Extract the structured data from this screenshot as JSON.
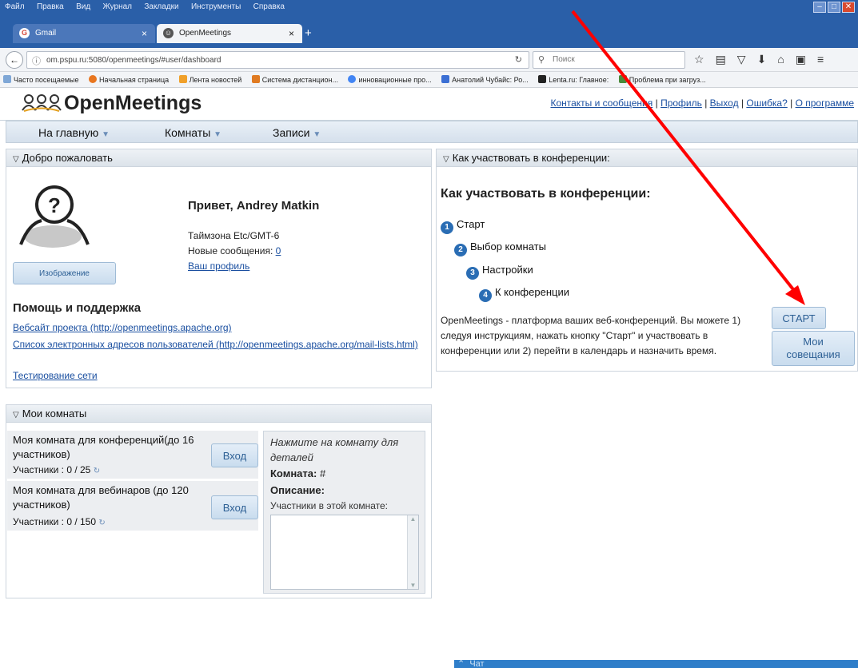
{
  "browser": {
    "menu": [
      "Файл",
      "Правка",
      "Вид",
      "Журнал",
      "Закладки",
      "Инструменты",
      "Справка"
    ],
    "tabs": [
      {
        "label": "Gmail",
        "icon": "gmail-icon"
      },
      {
        "label": "OpenMeetings",
        "icon": "openmeetings-icon"
      }
    ],
    "url": "om.pspu.ru:5080/openmeetings/#user/dashboard",
    "search_placeholder": "Поиск",
    "bookmarks": [
      "Часто посещаемые",
      "Начальная страница",
      "Лента новостей",
      "Система дистанцион...",
      "инновационные про...",
      "Анатолий Чубайс: Ро...",
      "Lenta.ru: Главное:",
      "Проблема при загруз..."
    ]
  },
  "app": {
    "logo": "OpenMeetings",
    "top_links": [
      "Контакты и сообщения",
      "Профиль",
      "Выход",
      "Ошибка?",
      "О программе"
    ],
    "nav": [
      "На главную",
      "Комнаты",
      "Записи"
    ]
  },
  "welcome": {
    "title": "Добро пожаловать",
    "greeting": "Привет, Andrey Matkin",
    "timezone": "Таймзона Etc/GMT-6",
    "new_messages_label": "Новые сообщения:",
    "new_messages_count": "0",
    "profile_link": "Ваш профиль",
    "image_button": "Изображение",
    "help_title": "Помощь и поддержка",
    "help_links": [
      "Вебсайт проекта (http://openmeetings.apache.org)",
      "Список электронных адресов пользователей (http://openmeetings.apache.org/mail-lists.html)",
      "Тестирование сети"
    ]
  },
  "howto": {
    "title": "Как участвовать в конференции:",
    "heading": "Как участвовать в конференции:",
    "steps": [
      "Старт",
      "Выбор комнаты",
      "Настройки",
      "К конференции"
    ],
    "description": "OpenMeetings - платформа ваших веб-конференций. Вы можете 1) следуя инструкциям, нажать кнопку \"Старт\" и участвовать в конференции или 2) перейти в календарь и назначить время.",
    "start_button": "СТАРТ",
    "meetings_button": "Мои совещания"
  },
  "rooms": {
    "title": "Мои комнаты",
    "items": [
      {
        "name": "Моя комната для конференций(до 16 участников)",
        "participants": "Участники : 0 / 25",
        "enter": "Вход"
      },
      {
        "name": "Моя комната для вебинаров (до 120 участников)",
        "participants": "Участники : 0 / 150",
        "enter": "Вход"
      }
    ],
    "details_hint": "Нажмите на комнату для деталей",
    "room_label": "Комната:",
    "room_value": "#",
    "description_label": "Описание:",
    "participants_in_room": "Участники в этой комнате:"
  },
  "chat": {
    "label": "Чат"
  },
  "colors": {
    "accent": "#2a6db4",
    "annotation_arrow": "#ff0000",
    "browser_frame": "#2a5fa8"
  }
}
